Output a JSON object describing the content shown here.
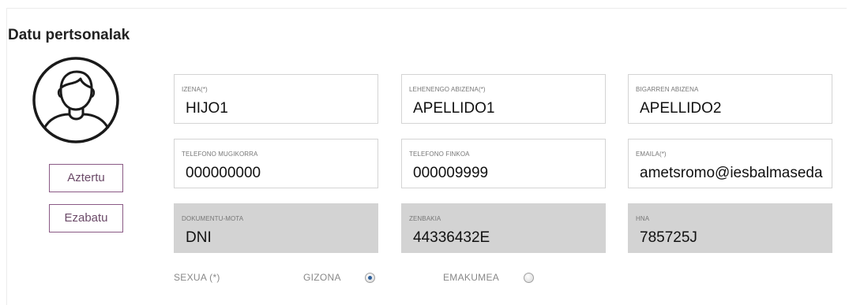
{
  "section": {
    "title": "Datu pertsonalak"
  },
  "avatar": {
    "icon": "user-avatar-icon"
  },
  "buttons": {
    "analyze": "Aztertu",
    "delete": "Ezabatu"
  },
  "fields": {
    "name": {
      "label": "IZENA(*)",
      "value": "HIJO1"
    },
    "first_surname": {
      "label": "LEHENENGO ABIZENA(*)",
      "value": "APELLIDO1"
    },
    "second_surname": {
      "label": "BIGARREN ABIZENA",
      "value": "APELLIDO2"
    },
    "mobile_phone": {
      "label": "TELEFONO MUGIKORRA",
      "value": "000000000"
    },
    "landline_phone": {
      "label": "TELEFONO FINKOA",
      "value": "000009999"
    },
    "email": {
      "label": "EMAILA(*)",
      "value": "ametsromo@iesbalmaseda"
    },
    "document_type": {
      "label": "DOKUMENTU-MOTA",
      "value": "DNI"
    },
    "document_number": {
      "label": "ZENBAKIA",
      "value": "44336432E"
    },
    "hna": {
      "label": "HNA",
      "value": "785725J"
    }
  },
  "sex": {
    "label": "SEXUA (*)",
    "options": [
      {
        "label": "GIZONA",
        "selected": true
      },
      {
        "label": "EMAKUMEA",
        "selected": false
      }
    ]
  },
  "colors": {
    "button_border": "#8a5a85",
    "disabled_field": "#d3d3d3",
    "radio_selected": "#2d5f9a"
  }
}
